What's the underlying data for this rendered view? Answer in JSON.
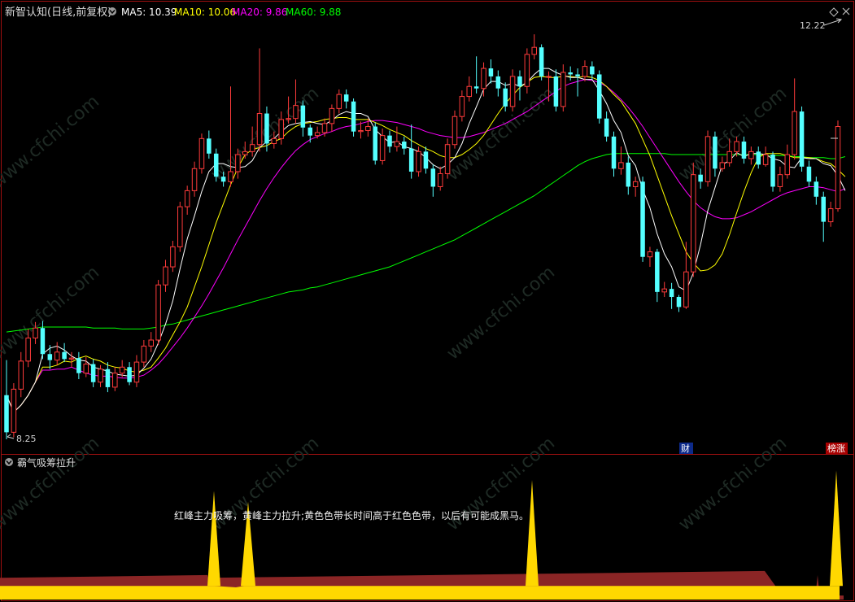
{
  "header": {
    "title": "新智认知(日线,前复权)",
    "ma": [
      {
        "label": "MA5: 10.39",
        "color": "#ffffff"
      },
      {
        "label": "MA10: 10.06",
        "color": "#ffff00"
      },
      {
        "label": "MA20: 9.86",
        "color": "#ff00ff"
      },
      {
        "label": "MA60: 9.88",
        "color": "#00ff00"
      }
    ]
  },
  "price_labels": {
    "high": "12.22",
    "low": "8.25"
  },
  "markers": {
    "cai": "财",
    "surge": "榜涨"
  },
  "indicator": {
    "title": "霸气吸筹拉升",
    "note": "红峰主力吸筹，黄峰主力拉升;黄色色带长时间高于红色色带，以后有可能成黑马。"
  },
  "watermark": "www.cfchi.com",
  "colors": {
    "up": "#ff3b3b",
    "down": "#54ffff",
    "ma5": "#ffffff",
    "ma10": "#ffff00",
    "ma20": "#ff00ff",
    "ma60": "#00ff00",
    "border": "#a01010",
    "red_band": "#8b2525",
    "yellow_band": "#ffd800"
  },
  "chart_data": {
    "type": "candlestick",
    "y_range": [
      8.05,
      12.4
    ],
    "candles": [
      [
        8.62,
        8.25,
        8.97,
        8.18
      ],
      [
        8.25,
        8.68,
        8.74,
        8.2
      ],
      [
        8.68,
        8.96,
        9.05,
        8.6
      ],
      [
        8.96,
        9.19,
        9.28,
        8.9
      ],
      [
        9.19,
        9.29,
        9.35,
        9.13
      ],
      [
        9.29,
        9.03,
        9.36,
        8.98
      ],
      [
        9.03,
        8.97,
        9.12,
        8.88
      ],
      [
        8.97,
        9.05,
        9.15,
        8.92
      ],
      [
        9.05,
        8.98,
        9.14,
        8.95
      ],
      [
        8.98,
        8.99,
        9.05,
        8.9
      ],
      [
        8.99,
        8.84,
        9.05,
        8.78
      ],
      [
        8.84,
        8.93,
        9.0,
        8.8
      ],
      [
        8.93,
        8.75,
        8.98,
        8.7
      ],
      [
        8.75,
        8.88,
        8.92,
        8.7
      ],
      [
        8.88,
        8.7,
        8.95,
        8.65
      ],
      [
        8.7,
        8.84,
        8.9,
        8.66
      ],
      [
        8.84,
        8.9,
        8.97,
        8.8
      ],
      [
        8.9,
        8.75,
        8.95,
        8.72
      ],
      [
        8.75,
        8.95,
        9.02,
        8.7
      ],
      [
        8.95,
        9.11,
        9.17,
        8.9
      ],
      [
        9.11,
        9.17,
        9.25,
        9.05
      ],
      [
        9.17,
        9.72,
        9.77,
        9.12
      ],
      [
        9.72,
        9.9,
        9.97,
        9.65
      ],
      [
        9.9,
        10.1,
        10.16,
        9.85
      ],
      [
        10.1,
        10.5,
        10.55,
        10.05
      ],
      [
        10.5,
        10.66,
        10.71,
        10.42
      ],
      [
        10.66,
        10.88,
        10.95,
        10.6
      ],
      [
        10.88,
        11.18,
        11.23,
        10.83
      ],
      [
        11.18,
        11.03,
        11.26,
        10.98
      ],
      [
        11.03,
        10.8,
        11.08,
        10.75
      ],
      [
        10.8,
        10.75,
        10.85,
        10.7
      ],
      [
        10.75,
        10.85,
        11.7,
        10.7
      ],
      [
        10.85,
        11.02,
        11.08,
        10.78
      ],
      [
        11.02,
        11.05,
        11.15,
        10.98
      ],
      [
        11.05,
        11.12,
        11.3,
        11.0
      ],
      [
        11.12,
        11.43,
        12.08,
        11.05
      ],
      [
        11.43,
        11.13,
        11.5,
        11.05
      ],
      [
        11.13,
        11.18,
        11.25,
        11.08
      ],
      [
        11.18,
        11.37,
        11.45,
        11.12
      ],
      [
        11.37,
        11.38,
        11.6,
        11.33
      ],
      [
        11.38,
        11.51,
        11.77,
        11.33
      ],
      [
        11.51,
        11.29,
        11.56,
        11.2
      ],
      [
        11.29,
        11.21,
        11.32,
        11.14
      ],
      [
        11.21,
        11.24,
        11.3,
        11.18
      ],
      [
        11.24,
        11.33,
        11.38,
        11.2
      ],
      [
        11.33,
        11.48,
        11.52,
        11.25
      ],
      [
        11.48,
        11.62,
        11.67,
        11.43
      ],
      [
        11.62,
        11.55,
        11.67,
        11.48
      ],
      [
        11.55,
        11.25,
        11.58,
        11.2
      ],
      [
        11.25,
        11.26,
        11.35,
        11.18
      ],
      [
        11.26,
        11.3,
        11.38,
        11.2
      ],
      [
        11.3,
        10.96,
        11.34,
        10.92
      ],
      [
        10.96,
        11.21,
        11.28,
        10.92
      ],
      [
        11.21,
        11.1,
        11.26,
        11.04
      ],
      [
        11.1,
        11.15,
        11.3,
        11.05
      ],
      [
        11.15,
        11.08,
        11.2,
        11.02
      ],
      [
        11.08,
        10.85,
        11.32,
        10.78
      ],
      [
        10.85,
        11.05,
        11.1,
        10.8
      ],
      [
        11.05,
        10.88,
        11.1,
        10.83
      ],
      [
        10.88,
        10.7,
        10.92,
        10.6
      ],
      [
        10.7,
        10.83,
        10.9,
        10.66
      ],
      [
        10.83,
        11.12,
        11.18,
        10.78
      ],
      [
        11.12,
        11.4,
        11.46,
        11.08
      ],
      [
        11.4,
        11.6,
        11.66,
        11.35
      ],
      [
        11.6,
        11.7,
        11.8,
        11.55
      ],
      [
        11.7,
        11.68,
        12.0,
        11.63
      ],
      [
        11.68,
        11.88,
        11.94,
        11.6
      ],
      [
        11.88,
        11.8,
        11.97,
        11.73
      ],
      [
        11.8,
        11.68,
        11.86,
        11.6
      ],
      [
        11.68,
        11.5,
        11.74,
        11.45
      ],
      [
        11.5,
        11.8,
        11.87,
        11.45
      ],
      [
        11.8,
        11.7,
        11.86,
        11.56
      ],
      [
        11.7,
        12.02,
        12.08,
        11.63
      ],
      [
        12.02,
        12.09,
        12.22,
        11.97
      ],
      [
        12.09,
        11.8,
        12.12,
        11.76
      ],
      [
        11.8,
        11.8,
        11.85,
        11.55
      ],
      [
        11.8,
        11.5,
        11.87,
        11.45
      ],
      [
        11.5,
        11.84,
        11.92,
        11.45
      ],
      [
        11.84,
        11.82,
        11.9,
        11.76
      ],
      [
        11.82,
        11.8,
        11.88,
        11.6
      ],
      [
        11.8,
        11.9,
        11.96,
        11.75
      ],
      [
        11.9,
        11.82,
        11.95,
        11.77
      ],
      [
        11.82,
        11.38,
        11.86,
        11.33
      ],
      [
        11.38,
        11.2,
        11.45,
        11.15
      ],
      [
        11.2,
        10.88,
        11.25,
        10.8
      ],
      [
        10.88,
        10.94,
        11.1,
        10.82
      ],
      [
        10.94,
        10.7,
        11.0,
        10.62
      ],
      [
        10.7,
        10.75,
        10.8,
        10.6
      ],
      [
        10.75,
        10.0,
        10.8,
        9.95
      ],
      [
        10.0,
        10.05,
        10.1,
        9.9
      ],
      [
        10.05,
        9.65,
        10.08,
        9.55
      ],
      [
        9.65,
        9.68,
        9.75,
        9.6
      ],
      [
        9.68,
        9.6,
        9.74,
        9.48
      ],
      [
        9.6,
        9.5,
        9.62,
        9.45
      ],
      [
        9.5,
        9.85,
        10.15,
        9.48
      ],
      [
        9.85,
        10.82,
        10.94,
        9.8
      ],
      [
        10.82,
        10.75,
        10.88,
        10.68
      ],
      [
        10.75,
        11.2,
        11.26,
        10.7
      ],
      [
        11.2,
        10.88,
        11.25,
        10.8
      ],
      [
        10.88,
        10.94,
        11.0,
        10.85
      ],
      [
        10.94,
        11.05,
        11.18,
        10.9
      ],
      [
        11.05,
        11.15,
        11.2,
        11.0
      ],
      [
        11.15,
        10.98,
        11.2,
        10.93
      ],
      [
        10.98,
        11.05,
        11.1,
        10.92
      ],
      [
        11.05,
        10.92,
        11.1,
        10.88
      ],
      [
        10.92,
        11.02,
        11.1,
        10.9
      ],
      [
        11.02,
        10.7,
        11.05,
        10.65
      ],
      [
        10.7,
        10.82,
        10.9,
        10.65
      ],
      [
        10.82,
        11.02,
        11.12,
        10.78
      ],
      [
        11.02,
        11.45,
        11.78,
        10.97
      ],
      [
        11.45,
        10.9,
        11.5,
        10.85
      ],
      [
        10.9,
        10.75,
        10.96,
        10.7
      ],
      [
        10.75,
        10.6,
        10.8,
        10.52
      ],
      [
        10.6,
        10.35,
        10.65,
        10.15
      ],
      [
        10.35,
        10.48,
        10.55,
        10.3
      ],
      [
        10.48,
        11.3,
        11.36,
        10.45
      ]
    ],
    "ma5": [
      8.62,
      8.45,
      8.52,
      8.62,
      8.75,
      9.03,
      9.09,
      9.11,
      9.07,
      9.01,
      8.97,
      8.96,
      8.9,
      8.88,
      8.86,
      8.83,
      8.82,
      8.81,
      8.82,
      8.89,
      8.98,
      9.14,
      9.33,
      9.56,
      9.88,
      10.18,
      10.41,
      10.65,
      10.85,
      10.93,
      10.93,
      10.9,
      10.89,
      10.9,
      10.96,
      11.09,
      11.15,
      11.18,
      11.25,
      11.31,
      11.33,
      11.34,
      11.35,
      11.33,
      11.32,
      11.36,
      11.42,
      11.45,
      11.43,
      11.43,
      11.4,
      11.27,
      11.2,
      11.14,
      11.15,
      11.1,
      11.08,
      11.05,
      10.99,
      10.92,
      10.88,
      10.92,
      10.99,
      11.13,
      11.33,
      11.5,
      11.67,
      11.75,
      11.75,
      11.71,
      11.73,
      11.7,
      11.74,
      11.82,
      11.88,
      11.88,
      11.84,
      11.81,
      11.79,
      11.79,
      11.77,
      11.77,
      11.66,
      11.53,
      11.36,
      11.24,
      11.01,
      10.91,
      10.67,
      10.49,
      10.23,
      10.03,
      9.9,
      9.7,
      9.66,
      9.84,
      10.12,
      10.46,
      10.69,
      10.92,
      10.96,
      11.04,
      11.0,
      11.03,
      11.03,
      11.02,
      10.98,
      10.96,
      10.9,
      10.89,
      10.99,
      10.98,
      10.98,
      10.93,
      10.91,
      10.81,
      10.66
    ],
    "ma10": [
      8.62,
      8.45,
      8.52,
      8.62,
      8.75,
      8.9,
      8.9,
      8.92,
      8.96,
      8.95,
      8.99,
      9.01,
      8.98,
      8.96,
      8.92,
      8.9,
      8.89,
      8.86,
      8.85,
      8.87,
      8.9,
      8.99,
      9.09,
      9.22,
      9.35,
      9.5,
      9.7,
      9.9,
      10.12,
      10.34,
      10.53,
      10.72,
      10.89,
      11.02,
      11.07,
      11.09,
      11.11,
      11.15,
      11.18,
      11.25,
      11.3,
      11.33,
      11.34,
      11.35,
      11.37,
      11.38,
      11.39,
      11.39,
      11.37,
      11.37,
      11.37,
      11.34,
      11.31,
      11.27,
      11.24,
      11.21,
      11.16,
      11.12,
      11.08,
      11.05,
      11.01,
      10.99,
      10.99,
      11.02,
      11.07,
      11.13,
      11.21,
      11.32,
      11.43,
      11.53,
      11.61,
      11.69,
      11.74,
      11.79,
      11.8,
      11.79,
      11.79,
      11.8,
      11.8,
      11.79,
      11.8,
      11.79,
      11.76,
      11.7,
      11.62,
      11.55,
      11.44,
      11.33,
      11.17,
      11.01,
      10.81,
      10.61,
      10.41,
      10.23,
      10.05,
      9.94,
      9.86,
      9.87,
      9.92,
      10.03,
      10.22,
      10.44,
      10.65,
      10.84,
      10.99,
      11.03,
      11.03,
      11.03,
      11.01,
      10.99,
      10.99,
      10.99,
      10.98,
      10.95,
      10.93,
      10.87,
      10.8
    ],
    "ma20": [
      8.62,
      8.45,
      8.52,
      8.62,
      8.75,
      8.87,
      8.87,
      8.88,
      8.88,
      8.9,
      8.87,
      8.84,
      8.82,
      8.81,
      8.81,
      8.8,
      8.79,
      8.79,
      8.8,
      8.82,
      8.87,
      8.93,
      9.01,
      9.1,
      9.19,
      9.29,
      9.4,
      9.51,
      9.63,
      9.76,
      9.89,
      10.03,
      10.17,
      10.3,
      10.43,
      10.56,
      10.68,
      10.79,
      10.89,
      10.98,
      11.06,
      11.12,
      11.17,
      11.2,
      11.23,
      11.25,
      11.28,
      11.3,
      11.31,
      11.33,
      11.35,
      11.36,
      11.36,
      11.35,
      11.34,
      11.32,
      11.3,
      11.28,
      11.25,
      11.23,
      11.21,
      11.2,
      11.19,
      11.19,
      11.2,
      11.22,
      11.24,
      11.27,
      11.3,
      11.33,
      11.37,
      11.41,
      11.45,
      11.5,
      11.55,
      11.6,
      11.65,
      11.7,
      11.73,
      11.75,
      11.77,
      11.76,
      11.74,
      11.7,
      11.64,
      11.57,
      11.49,
      11.4,
      11.3,
      11.19,
      11.08,
      10.97,
      10.86,
      10.75,
      10.65,
      10.56,
      10.49,
      10.44,
      10.4,
      10.38,
      10.38,
      10.39,
      10.42,
      10.45,
      10.49,
      10.53,
      10.57,
      10.61,
      10.64,
      10.66,
      10.68,
      10.7,
      10.7,
      10.69,
      10.67,
      10.65,
      10.68
    ],
    "ma60": [
      9.25,
      9.26,
      9.27,
      9.28,
      9.29,
      9.3,
      9.3,
      9.3,
      9.3,
      9.3,
      9.3,
      9.3,
      9.29,
      9.29,
      9.29,
      9.29,
      9.28,
      9.28,
      9.28,
      9.28,
      9.29,
      9.3,
      9.32,
      9.33,
      9.35,
      9.37,
      9.39,
      9.41,
      9.43,
      9.45,
      9.47,
      9.49,
      9.51,
      9.53,
      9.55,
      9.57,
      9.59,
      9.61,
      9.63,
      9.65,
      9.66,
      9.67,
      9.69,
      9.7,
      9.72,
      9.74,
      9.76,
      9.78,
      9.8,
      9.82,
      9.84,
      9.86,
      9.88,
      9.9,
      9.93,
      9.96,
      9.99,
      10.02,
      10.05,
      10.08,
      10.11,
      10.14,
      10.17,
      10.21,
      10.25,
      10.29,
      10.33,
      10.37,
      10.41,
      10.45,
      10.49,
      10.53,
      10.57,
      10.61,
      10.66,
      10.71,
      10.76,
      10.81,
      10.86,
      10.91,
      10.95,
      10.98,
      11.0,
      11.02,
      11.03,
      11.03,
      11.03,
      11.03,
      11.03,
      11.03,
      11.03,
      11.03,
      11.02,
      11.02,
      11.02,
      11.02,
      11.02,
      11.02,
      11.02,
      11.02,
      11.02,
      11.02,
      11.02,
      11.02,
      11.02,
      11.01,
      11.01,
      11.01,
      11.01,
      11.0,
      11.0,
      10.99,
      10.99,
      10.99,
      10.98,
      10.98,
      11.0
    ],
    "indicator": {
      "y_range": [
        0,
        100
      ],
      "red_band": [
        [
          0,
          16
        ],
        [
          255,
          18
        ],
        [
          256,
          16
        ],
        [
          940,
          21
        ],
        [
          958,
          6
        ],
        [
          1018,
          6
        ],
        [
          1020,
          3
        ],
        [
          1037,
          3
        ]
      ],
      "red_peaks": [
        [
          258,
          3,
          4
        ],
        [
          302,
          3,
          2
        ],
        [
          652,
          3,
          2
        ],
        [
          1005,
          3,
          2
        ]
      ],
      "yellow_band": [
        [
          0,
          10
        ],
        [
          240,
          10
        ],
        [
          246,
          10
        ],
        [
          252,
          10
        ],
        [
          264,
          10
        ],
        [
          290,
          9
        ],
        [
          300,
          10
        ],
        [
          315,
          10
        ],
        [
          630,
          10
        ],
        [
          640,
          10
        ],
        [
          660,
          10
        ],
        [
          665,
          10
        ],
        [
          950,
          10
        ],
        [
          1015,
          10
        ],
        [
          1022,
          10
        ],
        [
          1032,
          10
        ]
      ],
      "yellow_peaks": [
        [
          263,
          8,
          80
        ],
        [
          305,
          9,
          72
        ],
        [
          654,
          8,
          88
        ],
        [
          1028,
          8,
          95
        ]
      ]
    }
  }
}
